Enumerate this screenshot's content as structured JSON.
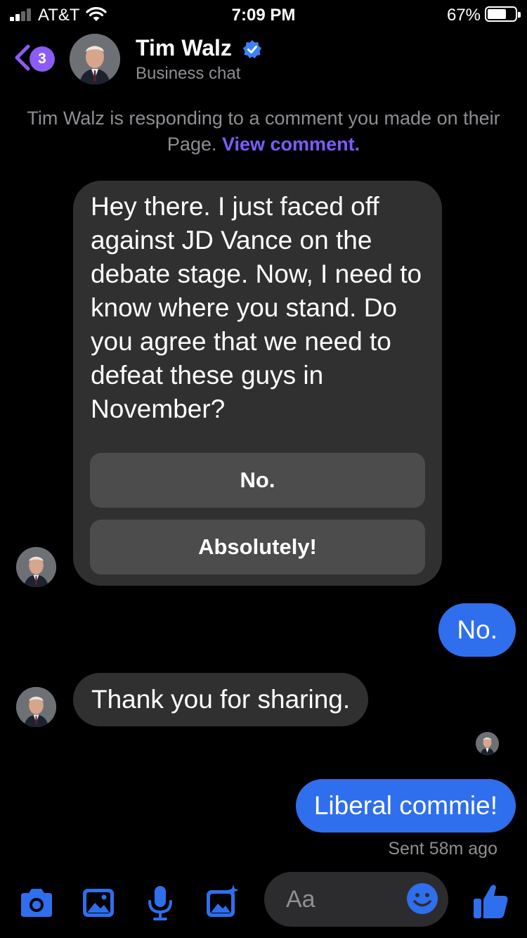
{
  "status_bar": {
    "carrier": "AT&T",
    "time": "7:09 PM",
    "battery_percent": "67%",
    "battery_level": 0.67
  },
  "header": {
    "back_badge_count": "3",
    "contact_name": "Tim Walz",
    "contact_subtitle": "Business chat",
    "verified": true
  },
  "notice": {
    "text": "Tim Walz is responding to a comment you made on their Page.",
    "link": "View comment."
  },
  "messages": [
    {
      "sender": "them",
      "text": "Hey there. I just faced off against JD Vance on the debate stage. Now, I need to know where you stand. Do you agree that we need to defeat these guys in November?",
      "quick_replies": [
        "No.",
        "Absolutely!"
      ]
    },
    {
      "sender": "me",
      "text": "No."
    },
    {
      "sender": "them",
      "text": "Thank you for sharing."
    },
    {
      "sender": "me",
      "text": "Liberal commie!"
    }
  ],
  "sent_status": "Sent 58m ago",
  "composer": {
    "placeholder": "Aa",
    "tools": [
      "camera-icon",
      "photo-icon",
      "microphone-icon",
      "sticker-image-icon"
    ],
    "emoji_icon": "smiley-icon",
    "like_icon": "thumbs-up-icon"
  },
  "colors": {
    "accent": "#2f6fed",
    "badge": "#8b5cf6",
    "link": "#7c5cff",
    "bubble_incoming": "#303030",
    "quick_reply_button": "#4c4c4c",
    "subtle_text": "#8e8e93"
  }
}
